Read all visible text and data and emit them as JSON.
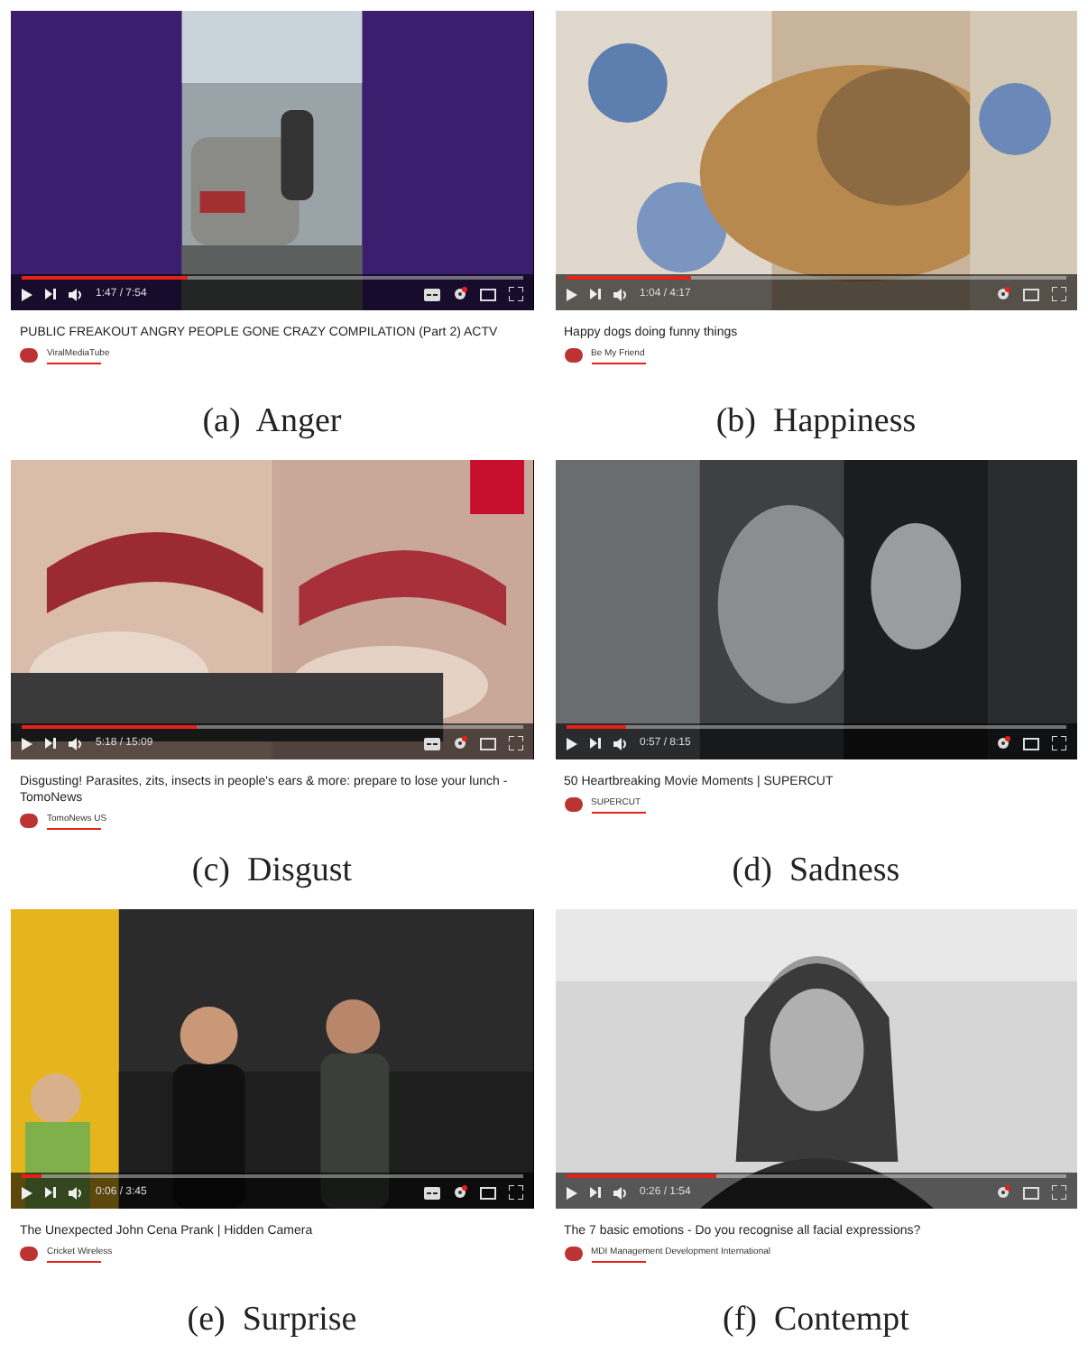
{
  "panels": [
    {
      "caption": "(a)  Anger",
      "title": "PUBLIC FREAKOUT ANGRY PEOPLE GONE CRAZY COMPILATION (Part 2) ACTV",
      "channel": "ViralMediaTube",
      "time": "1:47 / 7:54",
      "level": 0.33,
      "subtitles": true
    },
    {
      "caption": "(b)  Happiness",
      "title": "Happy dogs doing funny things",
      "channel": "Be My Friend",
      "time": "1:04 / 4:17",
      "level": 0.25,
      "subtitles": false
    },
    {
      "caption": "(c)  Disgust",
      "title": "Disgusting! Parasites, zits, insects in people's ears & more: prepare to lose your lunch - TomoNews",
      "channel": "TomoNews US",
      "time": "5:18 / 15:09",
      "level": 0.35,
      "subtitles": true
    },
    {
      "caption": "(d)  Sadness",
      "title": "50 Heartbreaking Movie Moments | SUPERCUT",
      "channel": "SUPERCUT",
      "time": "0:57 / 8:15",
      "level": 0.12,
      "subtitles": false
    },
    {
      "caption": "(e)  Surprise",
      "title": "The Unexpected John Cena Prank | Hidden Camera",
      "channel": "Cricket Wireless",
      "time": "0:06 / 3:45",
      "level": 0.04,
      "subtitles": true
    },
    {
      "caption": "(f)  Contempt",
      "title": "The 7 basic emotions - Do you recognise all facial expressions?",
      "channel": "MDI Management Development International",
      "time": "0:26 / 1:54",
      "level": 0.3,
      "subtitles": false
    }
  ]
}
